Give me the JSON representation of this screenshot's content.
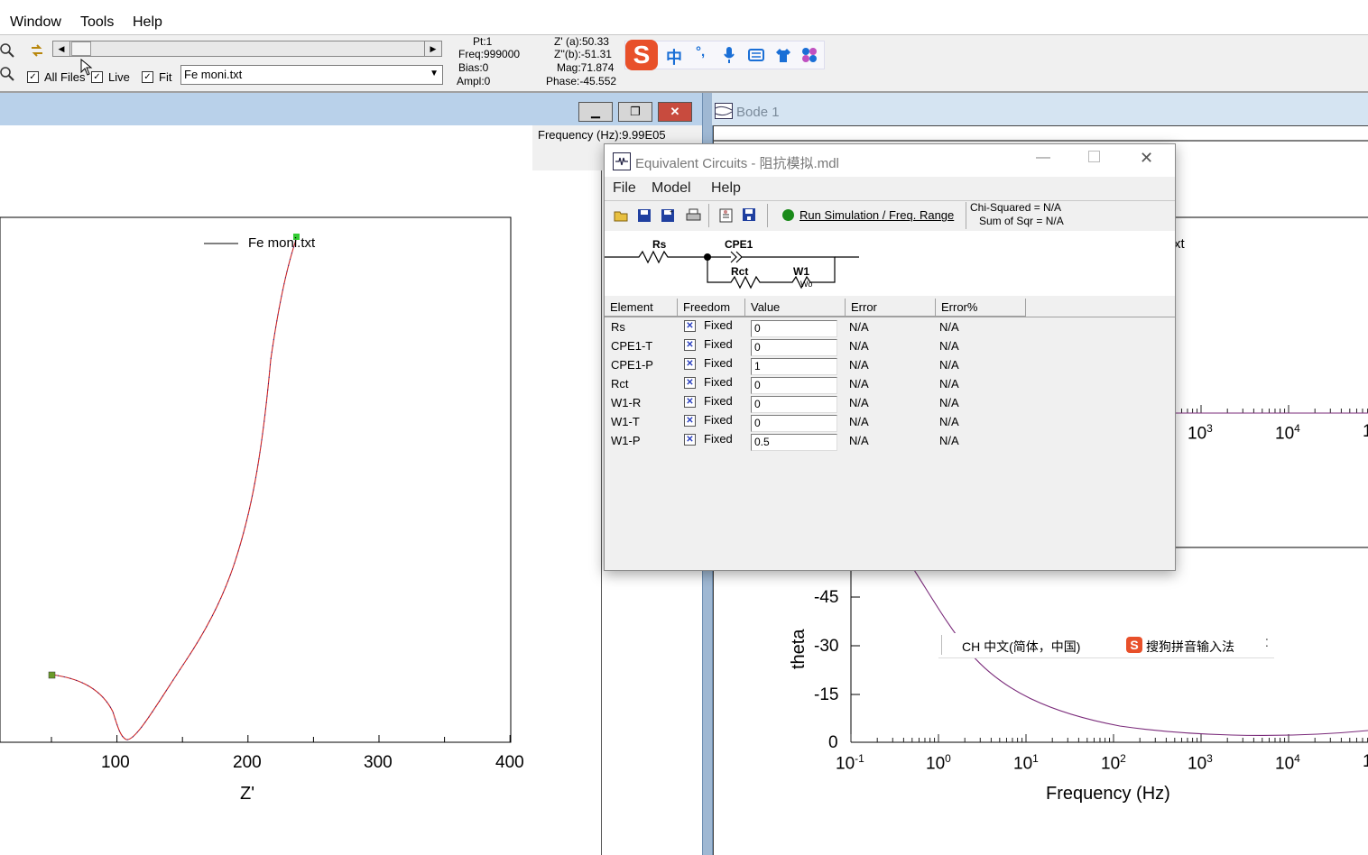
{
  "menubar": {
    "items": [
      "Window",
      "Tools",
      "Help"
    ]
  },
  "toolbar": {
    "all_files_label": "All Files",
    "live_label": "Live",
    "fit_label": "Fit",
    "file_select_value": "Fe moni.txt",
    "stats_col1": [
      "Pt:1",
      "Freq:999000",
      "Bias:0",
      "Ampl:0"
    ],
    "stats_col2": [
      "Z' (a):50.33",
      "Z''(b):-51.31",
      "Mag:71.874",
      "Phase:-45.552"
    ]
  },
  "ime_bar": {
    "chinese_label": "中",
    "punct_label": "°,"
  },
  "left_window": {
    "frequency_readout": "Frequency (Hz):9.99E05",
    "legend": "Fe moni.txt",
    "x_ticks": [
      "100",
      "200",
      "300",
      "400"
    ],
    "xlabel": "Z'"
  },
  "right_window": {
    "title": "Bode 1",
    "legend_fragment": "xt",
    "upper_x_ticks": [
      "10",
      "3",
      "10",
      "4",
      "1"
    ],
    "paren_fragment": ")",
    "y_ticks": [
      "-45",
      "-30",
      "-15",
      "0"
    ],
    "ylabel": "theta",
    "x_ticks": [
      [
        "10",
        "-1"
      ],
      [
        "10",
        "0"
      ],
      [
        "10",
        "1"
      ],
      [
        "10",
        "2"
      ],
      [
        "10",
        "3"
      ],
      [
        "10",
        "4"
      ],
      [
        "1",
        ""
      ]
    ],
    "xlabel": "Frequency (Hz)"
  },
  "ime_popup": {
    "language": "CH 中文(简体，中国)",
    "ime_name": "搜狗拼音输入法"
  },
  "dialog": {
    "title": "Equivalent Circuits - 阻抗模拟.mdl",
    "menu": [
      "File",
      "Model",
      "Help"
    ],
    "run_label": "Run Simulation / Freq. Range",
    "chi_squared": "Chi-Squared = N/A",
    "sum_of_sqr": "Sum of Sqr = N/A",
    "circuit_labels": {
      "rs": "Rs",
      "cpe": "CPE1",
      "rct": "Rct",
      "w1": "W1",
      "wo": "Wo"
    },
    "columns": [
      "Element",
      "Freedom",
      "Value",
      "Error",
      "Error%"
    ],
    "rows": [
      {
        "element": "Rs",
        "freedom": "Fixed",
        "value": "0",
        "error": "N/A",
        "error_pct": "N/A"
      },
      {
        "element": "CPE1-T",
        "freedom": "Fixed",
        "value": "0",
        "error": "N/A",
        "error_pct": "N/A"
      },
      {
        "element": "CPE1-P",
        "freedom": "Fixed",
        "value": "1",
        "error": "N/A",
        "error_pct": "N/A"
      },
      {
        "element": "Rct",
        "freedom": "Fixed",
        "value": "0",
        "error": "N/A",
        "error_pct": "N/A"
      },
      {
        "element": "W1-R",
        "freedom": "Fixed",
        "value": "0",
        "error": "N/A",
        "error_pct": "N/A"
      },
      {
        "element": "W1-T",
        "freedom": "Fixed",
        "value": "0",
        "error": "N/A",
        "error_pct": "N/A"
      },
      {
        "element": "W1-P",
        "freedom": "Fixed",
        "value": "0.5",
        "error": "N/A",
        "error_pct": "N/A"
      }
    ]
  },
  "colors": {
    "window_title_active": "#b9d1ea",
    "curve": "#cc2222",
    "bode_curve": "#7a2a7a",
    "run_dot": "#1a8a1a"
  }
}
